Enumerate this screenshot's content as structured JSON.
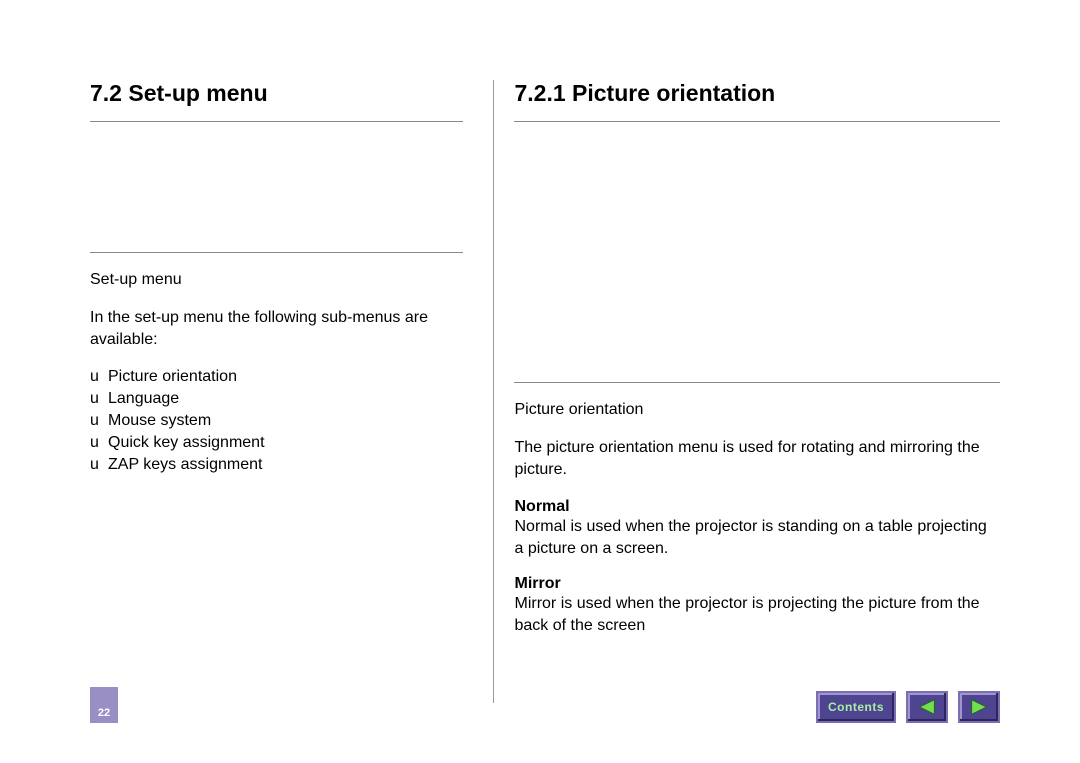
{
  "left": {
    "heading": "7.2  Set-up menu",
    "subhead": "Set-up menu",
    "intro": "In the set-up menu the following sub-menus are available:",
    "bullets": [
      {
        "prefix": "u",
        "text": "Picture orientation"
      },
      {
        "prefix": "u",
        "text": "Language"
      },
      {
        "prefix": "u",
        "text": "Mouse system"
      },
      {
        "prefix": "u",
        "text": "Quick key assignment"
      },
      {
        "prefix": "u",
        "text": "ZAP keys assignment"
      }
    ]
  },
  "right": {
    "heading": "7.2.1  Picture orientation",
    "subhead": "Picture orientation",
    "intro": "The picture orientation menu is used for rotating and mirroring the picture.",
    "items": [
      {
        "term": "Normal",
        "desc": "Normal is used when the projector is standing on a table projecting a picture on a screen."
      },
      {
        "term": "Mirror",
        "desc": "Mirror is used when the projector is projecting the picture from the back of the screen"
      }
    ]
  },
  "footer": {
    "page": "22",
    "contents": "Contents"
  }
}
